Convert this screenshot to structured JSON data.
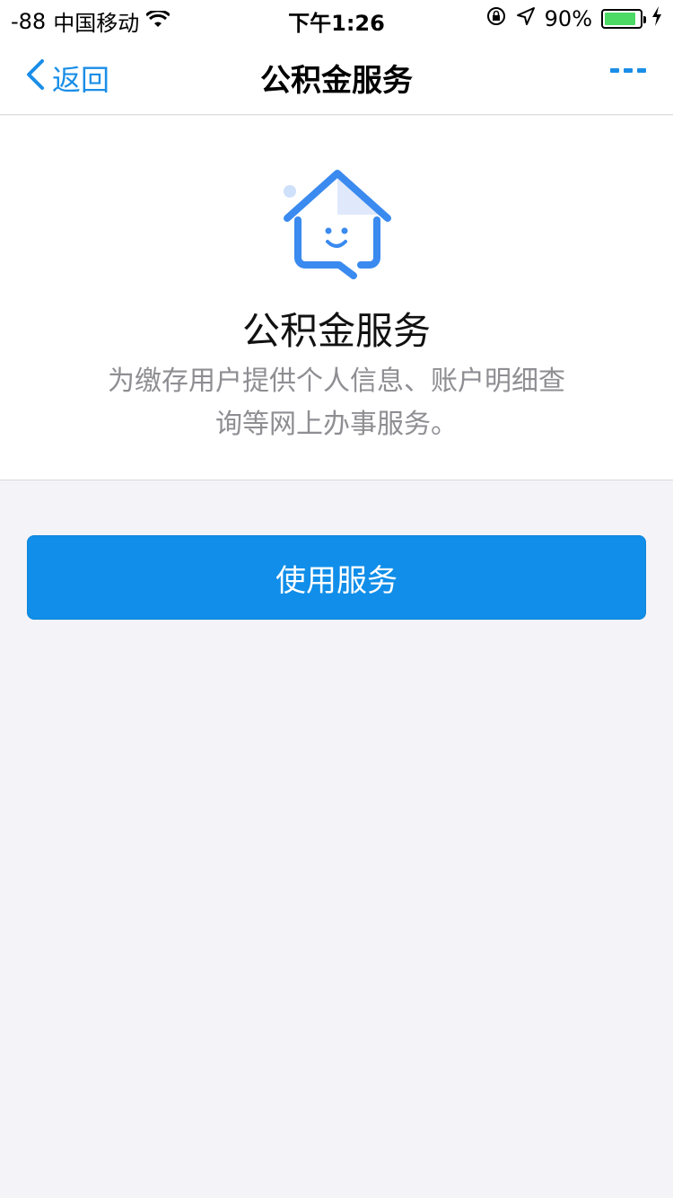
{
  "status_bar": {
    "signal": "-88",
    "carrier": "中国移动",
    "time": "下午1:26",
    "battery": "90%",
    "battery_level": 0.9,
    "icons": [
      "wifi-icon",
      "rotation-lock-icon",
      "location-icon",
      "battery-icon",
      "charging-icon"
    ]
  },
  "nav": {
    "back_label": "返回",
    "title": "公积金服务"
  },
  "service": {
    "title": "公积金服务",
    "description": "为缴存用户提供个人信息、账户明细查询等网上办事服务。"
  },
  "actions": {
    "use_label": "使用服务"
  },
  "colors": {
    "accent": "#108ee9",
    "link": "#1a8ee8",
    "background": "#f3f3f8",
    "secondary_text": "#8e8e93",
    "battery": "#4cd964"
  }
}
